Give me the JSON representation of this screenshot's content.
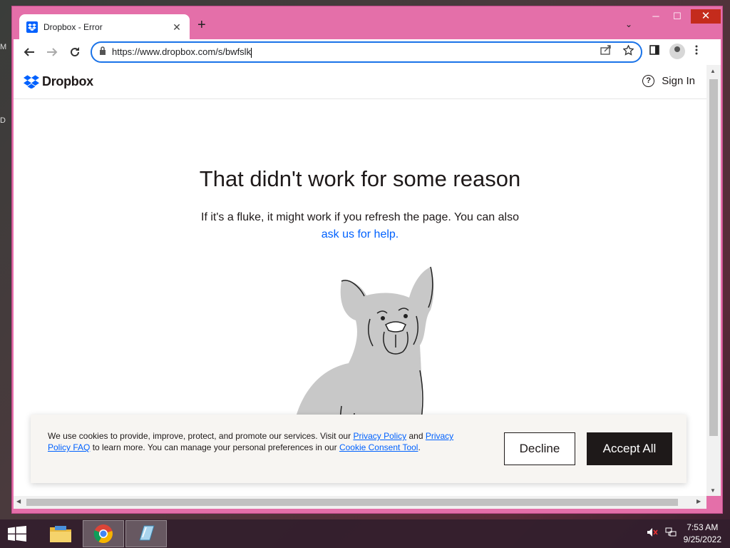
{
  "desktop": {
    "frag1": "M",
    "frag2": "D"
  },
  "browser": {
    "tab_title": "Dropbox - Error",
    "tab_close": "✕",
    "new_tab": "+",
    "tab_search": "⌄",
    "url": "https://www.dropbox.com/s/bwfslk",
    "window_min": "─",
    "window_max": "☐",
    "window_close": "✕"
  },
  "site": {
    "logo_text": "Dropbox",
    "sign_in": "Sign In",
    "help_glyph": "?"
  },
  "error": {
    "headline": "That didn't work for some reason",
    "subtext": "If it's a fluke, it might work if you refresh the page. You can also",
    "help_link": "ask us for help."
  },
  "cookie": {
    "text_1": "We use cookies to provide, improve, protect, and promote our services. Visit our",
    "privacy_link": "Privacy Policy",
    "text_2": "and",
    "faq_link": "Privacy Policy FAQ",
    "text_3": "to learn more. You can manage your personal preferences in our",
    "consent_link": "Cookie Consent Tool",
    "text_4": ".",
    "decline": "Decline",
    "accept": "Accept All"
  },
  "taskbar": {
    "time": "7:53 AM",
    "date": "9/25/2022"
  },
  "colors": {
    "window_frame": "#e46fa9",
    "dropbox_blue": "#0061fe",
    "accept_bg": "#1e1919"
  }
}
